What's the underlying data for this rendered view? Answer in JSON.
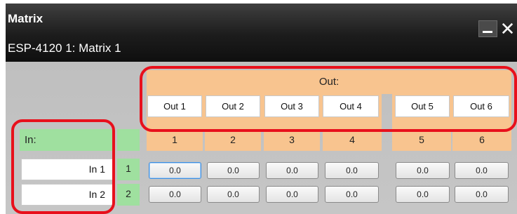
{
  "window": {
    "title": "Matrix",
    "subtitle": "ESP-4120 1: Matrix 1",
    "minimize_icon": "minimize-icon",
    "close_glyph": "✕",
    "close_icon": "close-icon"
  },
  "matrix": {
    "out_header": "Out:",
    "in_header": "In:",
    "outputs": [
      {
        "label": "Out 1",
        "number": "1"
      },
      {
        "label": "Out 2",
        "number": "2"
      },
      {
        "label": "Out 3",
        "number": "3"
      },
      {
        "label": "Out 4",
        "number": "4"
      },
      {
        "label": "Out 5",
        "number": "5"
      },
      {
        "label": "Out 6",
        "number": "6"
      }
    ],
    "inputs": [
      {
        "label": "In 1",
        "number": "1",
        "gains": [
          "0.0",
          "0.0",
          "0.0",
          "0.0",
          "0.0",
          "0.0"
        ]
      },
      {
        "label": "In 2",
        "number": "2",
        "gains": [
          "0.0",
          "0.0",
          "0.0",
          "0.0",
          "0.0",
          "0.0"
        ]
      }
    ]
  },
  "colors": {
    "titlebar": "#1c1c1c",
    "panel": "#c6c6c6",
    "output_accent": "#f8c48f",
    "input_accent": "#9fe09f",
    "callout": "#e8101c",
    "focus": "#3d8ee0"
  }
}
